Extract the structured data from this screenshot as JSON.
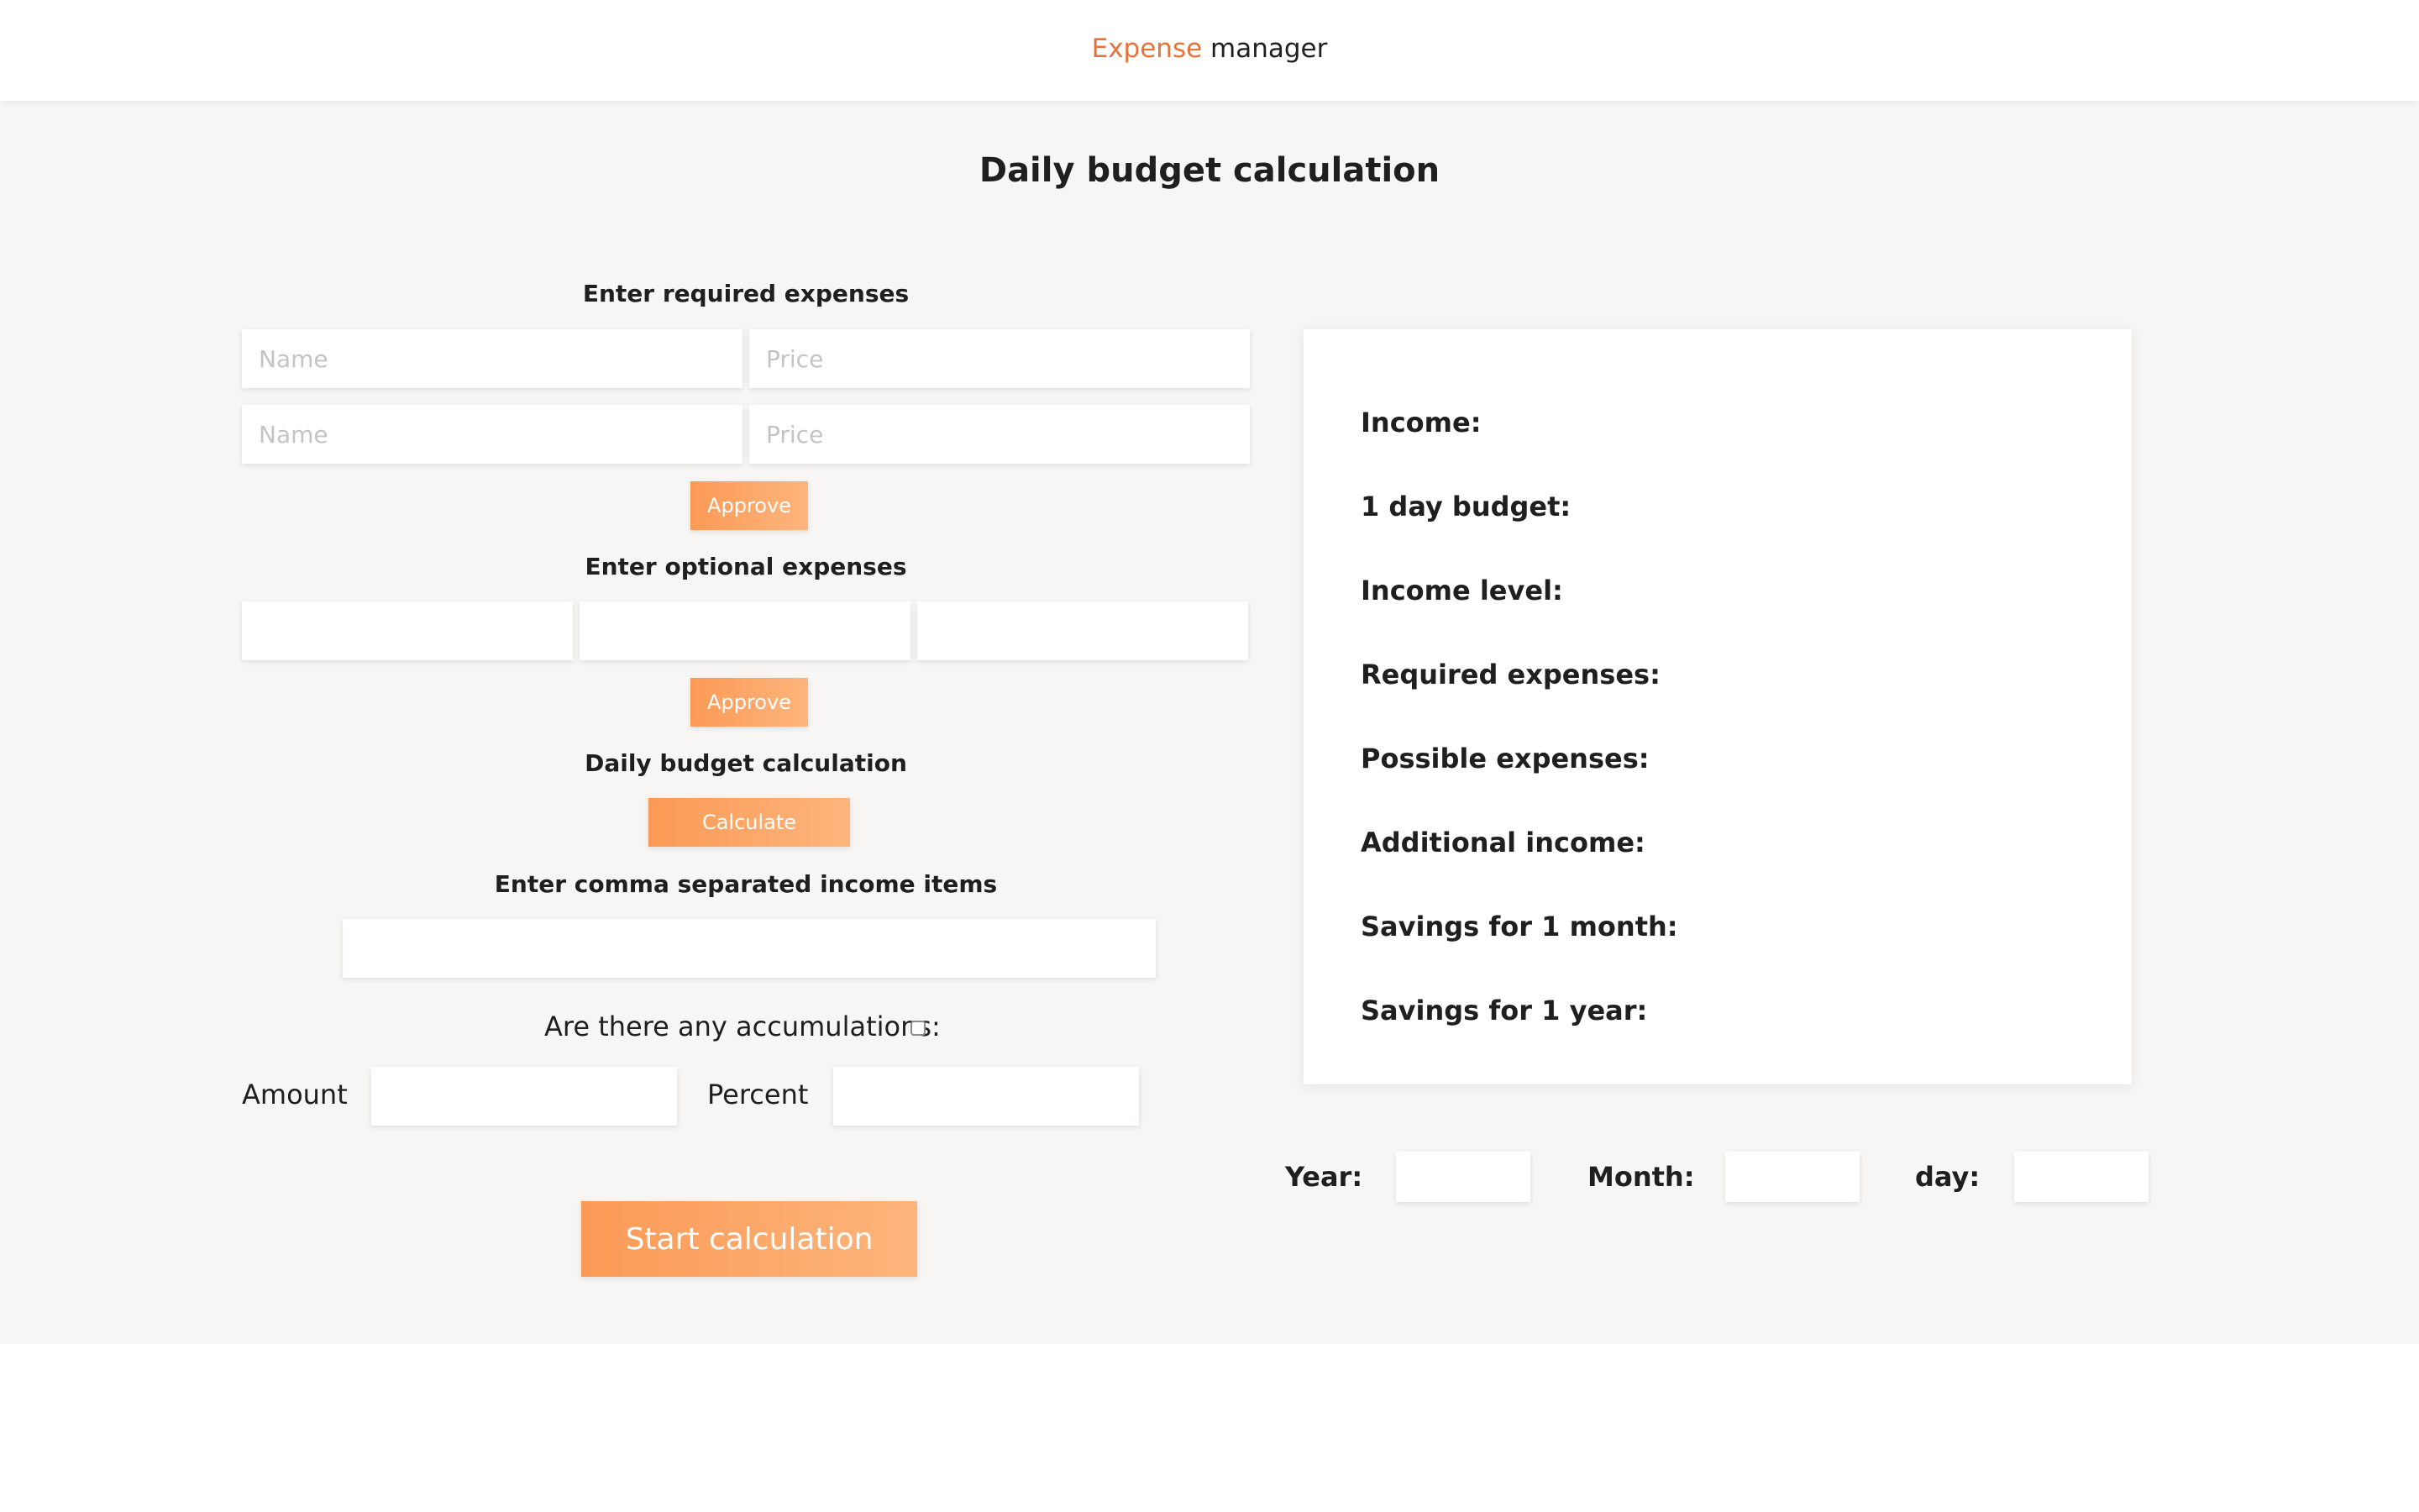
{
  "header": {
    "brand_accent": "Expense",
    "brand_rest": " manager"
  },
  "page_title": "Daily budget calculation",
  "required_expenses": {
    "heading": "Enter required expenses",
    "rows": [
      {
        "name_placeholder": "Name",
        "price_placeholder": "Price"
      },
      {
        "name_placeholder": "Name",
        "price_placeholder": "Price"
      }
    ],
    "approve_label": "Approve"
  },
  "optional_expenses": {
    "heading": "Enter optional expenses",
    "approve_label": "Approve"
  },
  "daily_budget": {
    "heading": "Daily budget calculation",
    "calculate_label": "Calculate"
  },
  "income": {
    "heading": "Enter comma separated income items"
  },
  "accumulations": {
    "question": "Are there any accumulations:",
    "checked": false,
    "amount_label": "Amount",
    "percent_label": "Percent"
  },
  "start_button_label": "Start calculation",
  "results": {
    "income": "Income:",
    "day_budget": "1 day budget:",
    "income_level": "Income level:",
    "required_expenses": "Required expenses:",
    "possible_expenses": "Possible expenses:",
    "additional_income": "Additional income:",
    "savings_month": "Savings for 1 month:",
    "savings_year": "Savings for 1 year:"
  },
  "date": {
    "year_label": "Year:",
    "month_label": "Month:",
    "day_label": "day:"
  },
  "colors": {
    "accent": "#e8733a",
    "button_start": "#fb9a56",
    "button_end": "#fdb57c",
    "background": "#f7f6f4"
  }
}
